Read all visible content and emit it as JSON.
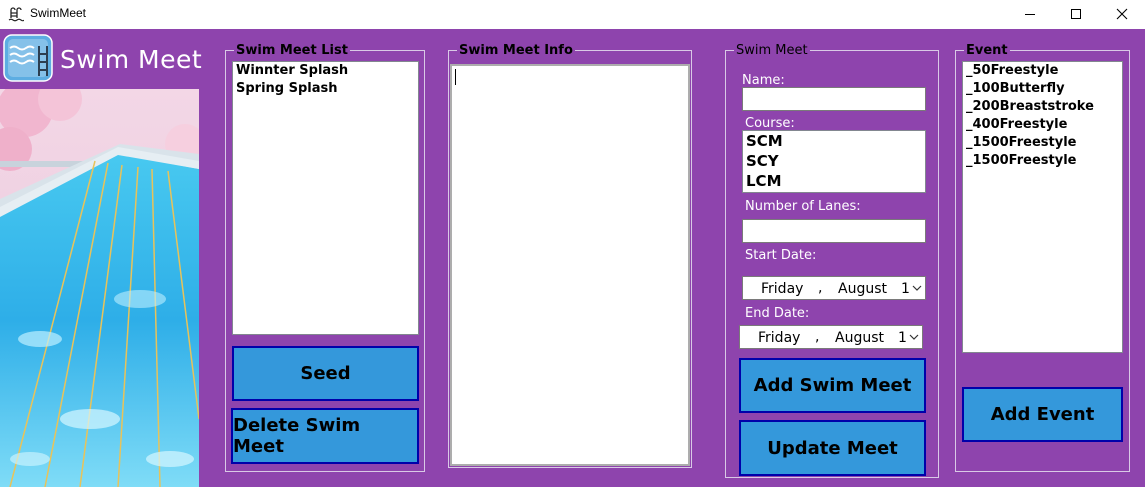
{
  "window": {
    "title": "SwimMeet",
    "controls": {
      "minimize": "minimize-icon",
      "maximize": "maximize-icon",
      "close": "close-icon"
    }
  },
  "app": {
    "logo_text": "Swim Meet"
  },
  "swim_meet_list": {
    "legend": "Swim Meet List",
    "items": [
      "Winnter Splash",
      "Spring Splash"
    ],
    "seed_label": "Seed",
    "delete_label": "Delete Swim Meet"
  },
  "swim_meet_info": {
    "legend": "Swim Meet Info",
    "value": ""
  },
  "swim_meet_form": {
    "legend": "Swim Meet",
    "name_label": "Name:",
    "name_value": "",
    "course_label": "Course:",
    "course_options": [
      "SCM",
      "SCY",
      "LCM"
    ],
    "lanes_label": "Number of Lanes:",
    "lanes_value": "",
    "start_label": "Start Date:",
    "start_date": {
      "day": "Friday",
      "sep": ",",
      "month": "August",
      "num": "1"
    },
    "end_label": "End Date:",
    "end_date": {
      "day": "Friday",
      "sep": ",",
      "month": "August",
      "num": "1"
    },
    "add_label": "Add Swim Meet",
    "update_label": "Update Meet"
  },
  "event": {
    "legend": "Event",
    "items": [
      "_50Freestyle",
      "_100Butterfly",
      "_200Breaststroke",
      "_400Freestyle",
      "_1500Freestyle",
      "_1500Freestyle"
    ],
    "add_label": "Add Event"
  },
  "colors": {
    "background": "#8e44ad",
    "button": "#3498db",
    "button_border": "#0000aa"
  }
}
